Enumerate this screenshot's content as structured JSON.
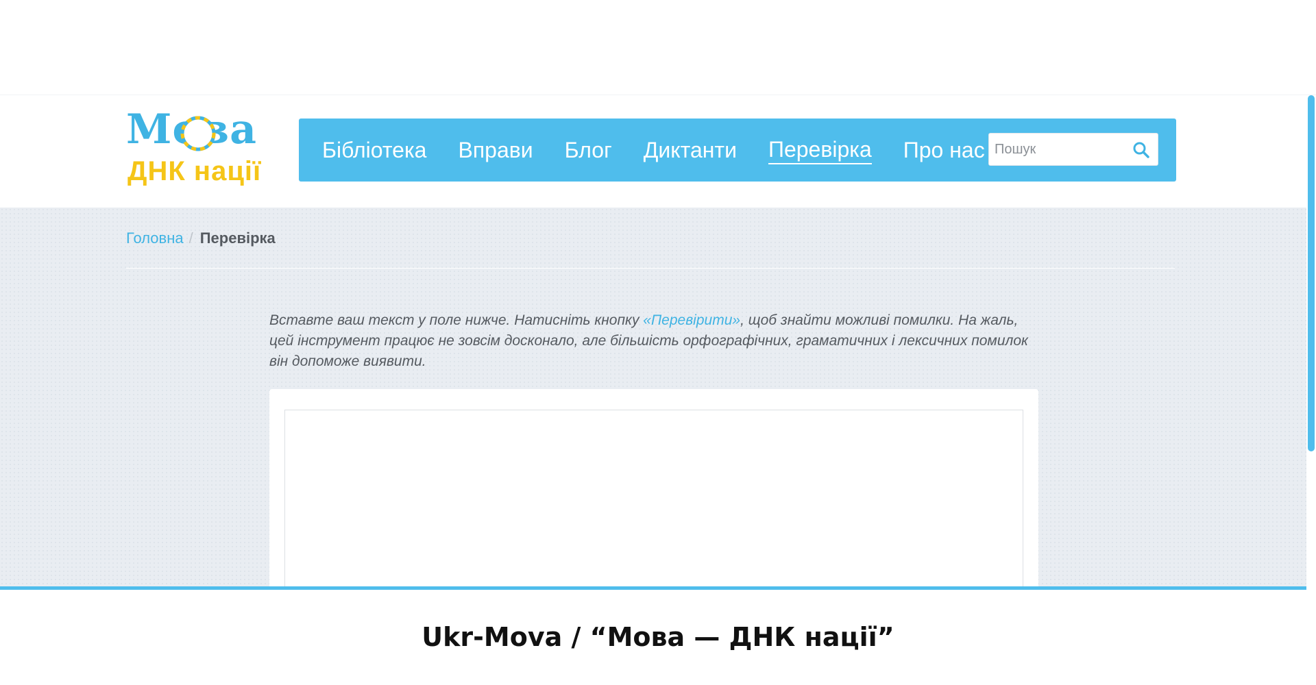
{
  "logo": {
    "line1": "Мова",
    "line2": "ДНК нації"
  },
  "nav": {
    "items": [
      {
        "label": "Бібліотека",
        "active": false
      },
      {
        "label": "Вправи",
        "active": false
      },
      {
        "label": "Блог",
        "active": false
      },
      {
        "label": "Диктанти",
        "active": false
      },
      {
        "label": "Перевірка",
        "active": true
      },
      {
        "label": "Про нас",
        "active": false
      }
    ]
  },
  "search": {
    "placeholder": "Пошук",
    "value": ""
  },
  "breadcrumb": {
    "home": "Головна",
    "separator": "/",
    "current": "Перевірка"
  },
  "intro": {
    "part1": "Вставте ваш текст у поле нижче. Натисніть кнопку ",
    "link": "«Перевірити»",
    "part2": ", щоб знайти можливі помилки. На жаль, цей інструмент працює не зовсім досконало, але більшість орфографічних, граматичних і лексичних помилок він допоможе виявити."
  },
  "editor": {
    "value": ""
  },
  "caption": "Ukr-Mova / “Мова — ДНК нації”",
  "colors": {
    "accent": "#4fbdec",
    "logo_blue": "#3fb3e3",
    "logo_yellow": "#f5c518",
    "page_bg": "#e9edf2"
  },
  "icons": {
    "search": "search-icon",
    "logo_ring": "dna-ring-icon"
  }
}
